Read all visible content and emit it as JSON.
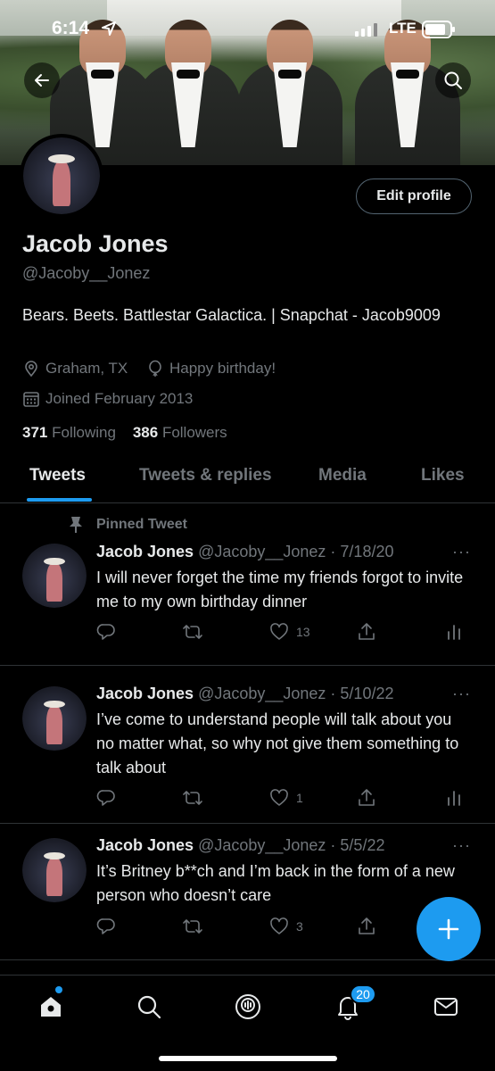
{
  "status_bar": {
    "time": "6:14",
    "network": "LTE"
  },
  "profile": {
    "name": "Jacob Jones",
    "handle": "@Jacoby__Jonez",
    "bio": "Bears. Beets. Battlestar Galactica. | Snapchat - Jacob9009",
    "location": "Graham, TX",
    "birthday": "Happy birthday!",
    "joined": "Joined February 2013",
    "following_count": "371",
    "following_label": "Following",
    "followers_count": "386",
    "followers_label": "Followers",
    "edit_label": "Edit profile"
  },
  "tabs": [
    "Tweets",
    "Tweets & replies",
    "Media",
    "Likes"
  ],
  "pinned_label": "Pinned Tweet",
  "tweets": [
    {
      "name": "Jacob Jones",
      "meta": "@Jacoby__Jonez · 7/18/20",
      "text": "I will never forget the time my friends forgot to invite me to my own birthday dinner",
      "likes": "13"
    },
    {
      "name": "Jacob Jones",
      "meta": "@Jacoby__Jonez · 5/10/22",
      "text": "I’ve come to understand people will talk about you no matter what, so why not give them something to talk about",
      "likes": "1"
    },
    {
      "name": "Jacob Jones",
      "meta": "@Jacoby__Jonez · 5/5/22",
      "text": "It’s Britney b**ch and I’m back in the form of a new person who doesn’t care",
      "likes": "3"
    }
  ],
  "more_glyph": "···",
  "notifications_badge": "20",
  "colors": {
    "accent": "#1d9bf0",
    "background": "#000000",
    "muted": "#71767b"
  }
}
